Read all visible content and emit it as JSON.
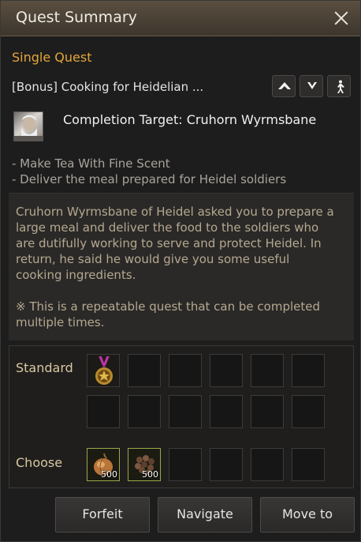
{
  "window": {
    "title": "Quest Summary"
  },
  "quest": {
    "type": "Single Quest",
    "name": "[Bonus] Cooking for Heidelian ...",
    "completion_target": "Completion Target: Cruhorn Wyrmsbane",
    "objectives": [
      "- Make Tea With Fine Scent",
      "- Deliver the meal prepared for Heidel soldiers"
    ],
    "description": "Cruhorn Wyrmsbane of Heidel asked you to prepare a large meal and deliver the food to the soldiers who are dutifully working to serve and protect Heidel. In return, he said he would give you some useful cooking ingredients.",
    "note": "※ This is a repeatable quest that can be completed multiple times."
  },
  "rewards": {
    "standard_label": "Standard",
    "choose_label": "Choose",
    "choose_items": [
      {
        "icon": "onion-icon",
        "quantity": "500"
      },
      {
        "icon": "beans-icon",
        "quantity": "500"
      }
    ]
  },
  "buttons": {
    "forfeit": "Forfeit",
    "navigate": "Navigate",
    "move_to": "Move to"
  },
  "colors": {
    "accent": "#e2a63a",
    "description_text": "#b6a88f",
    "slot_highlight": "#9aa84a"
  }
}
